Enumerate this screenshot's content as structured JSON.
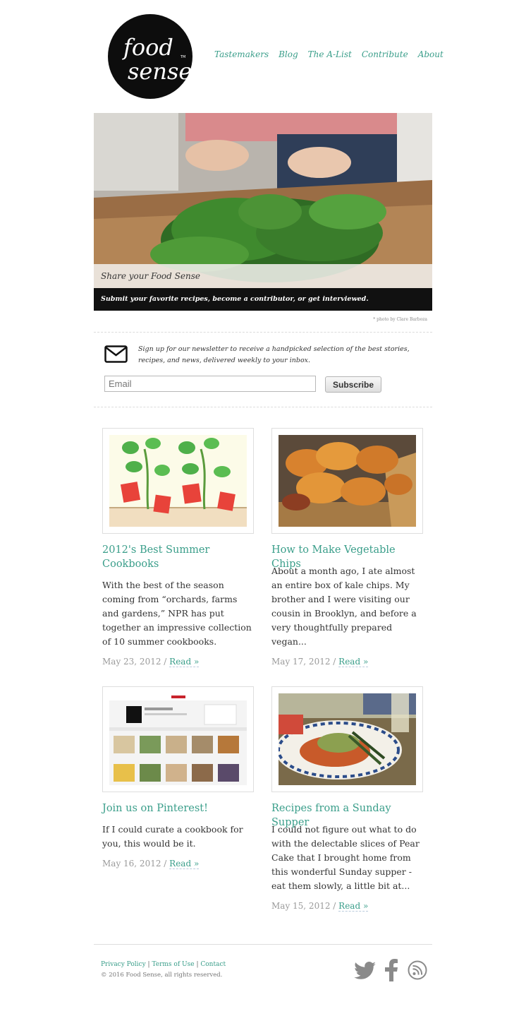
{
  "brand": {
    "logo_line1": "food",
    "logo_line2": "sense",
    "logo_tm": "TM"
  },
  "nav": [
    {
      "label": "Tastemakers"
    },
    {
      "label": "Blog"
    },
    {
      "label": "The A-List"
    },
    {
      "label": "Contribute"
    },
    {
      "label": "About"
    }
  ],
  "hero": {
    "caption": "Share your Food Sense",
    "tagline": "Submit your favorite recipes, become a contributor, or get interviewed.",
    "photo_credit": "* photo by Clare Barboza"
  },
  "newsletter": {
    "text": "Sign up for our newsletter to receive a handpicked selection of the best stories, recipes, and news, delivered weekly to your inbox.",
    "email_placeholder": "Email",
    "button_label": "Subscribe"
  },
  "posts": [
    {
      "title": "2012's Best Summer Cookbooks",
      "excerpt": "With the best of the season coming from “orchards, farms and gardens,” NPR has put together an impressive collection of 10 summer cookbooks.",
      "date": "May 23, 2012",
      "read_label": "Read »"
    },
    {
      "title": "How to Make Vegetable Chips",
      "excerpt": "About a month ago, I ate almost an entire box of kale chips. My brother and I were visiting our cousin in Brooklyn, and before a very thoughtfully prepared vegan...",
      "date": "May 17, 2012",
      "read_label": "Read »"
    },
    {
      "title": "Join us on Pinterest!",
      "excerpt": "If I could curate a cookbook for you, this would be it.",
      "date": "May 16, 2012",
      "read_label": "Read »"
    },
    {
      "title": "Recipes from a Sunday Supper",
      "excerpt": "I could not figure out what to do with the delectable slices of Pear Cake that I brought home from this wonderful Sunday supper - eat them slowly, a little bit at...",
      "date": "May 15, 2012",
      "read_label": "Read »"
    }
  ],
  "footer": {
    "links": [
      {
        "label": "Privacy Policy"
      },
      {
        "label": "Terms of Use"
      },
      {
        "label": "Contact"
      }
    ],
    "separator": "|",
    "copyright": "© 2016 Food Sense, all rights reserved."
  },
  "colors": {
    "accent": "#3a9e8a",
    "text": "#333333",
    "muted": "#9a9a9a",
    "hero_bar": "#111111"
  },
  "icons": {
    "mail": "envelope-icon",
    "twitter": "twitter-bird-icon",
    "facebook": "facebook-icon",
    "rss": "rss-icon"
  }
}
